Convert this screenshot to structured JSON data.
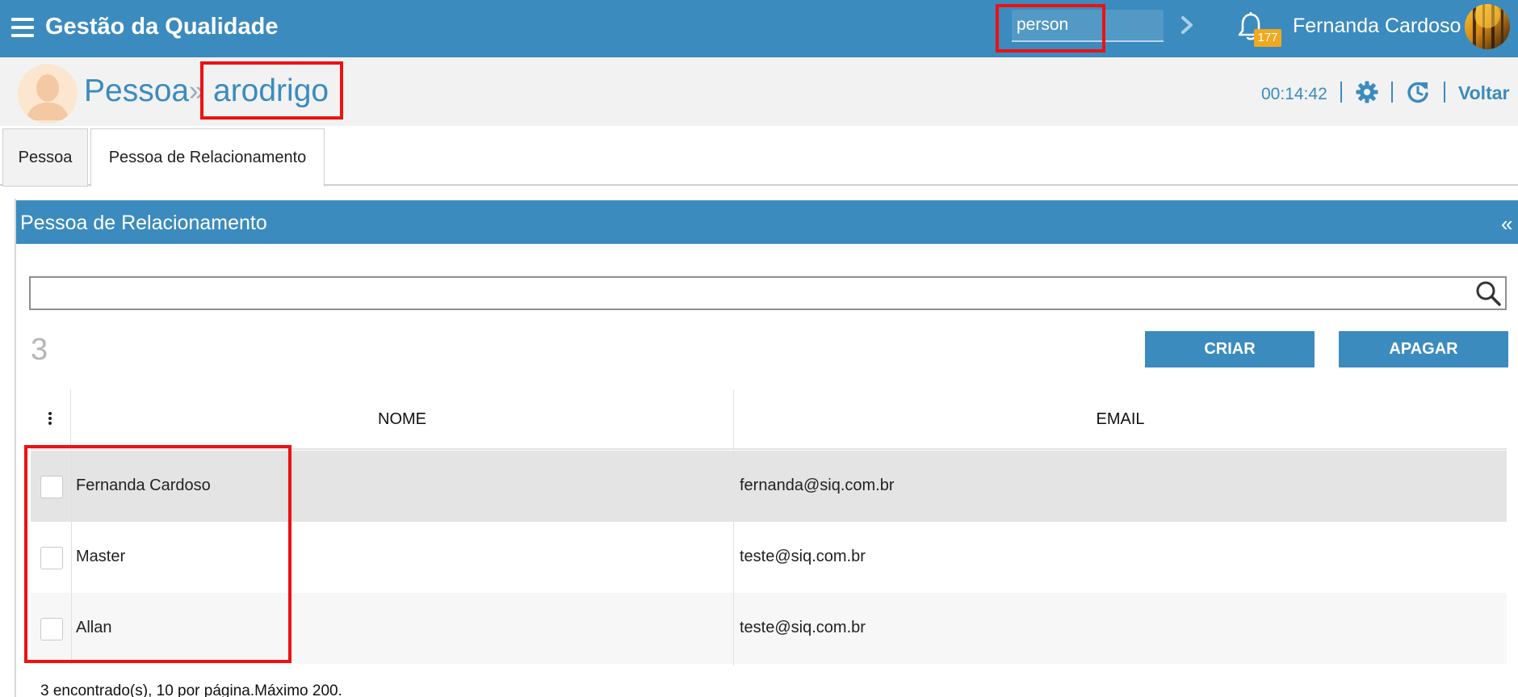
{
  "topbar": {
    "title": "Gestão da Qualidade",
    "search_value": "person",
    "notification_count": "177",
    "user_name": "Fernanda Cardoso"
  },
  "header": {
    "breadcrumb_root": "Pessoa",
    "breadcrumb_separator": "»",
    "breadcrumb_leaf": "arodrigo",
    "timer": "00:14:42",
    "back_label": "Voltar"
  },
  "tabs": [
    {
      "label": "Pessoa",
      "active": false
    },
    {
      "label": "Pessoa de Relacionamento",
      "active": true
    }
  ],
  "panel": {
    "title": "Pessoa de Relacionamento",
    "collapse_symbol": "«",
    "search_value": "",
    "count": "3",
    "create_label": "CRIAR",
    "delete_label": "APAGAR"
  },
  "table": {
    "columns": [
      "NOME",
      "EMAIL"
    ],
    "rows": [
      {
        "name": "Fernanda Cardoso",
        "email": "fernanda@siq.com.br",
        "checked": false
      },
      {
        "name": "Master",
        "email": "teste@siq.com.br",
        "checked": false
      },
      {
        "name": "Allan",
        "email": "teste@siq.com.br",
        "checked": false
      }
    ],
    "footer": "3 encontrado(s), 10 por página.Máximo 200."
  },
  "colors": {
    "primary": "#3b8bbf",
    "badge": "#f2a81d",
    "highlight": "#ee1111",
    "header_bg": "#f2f2f2"
  },
  "icons": {
    "menu": "hamburger-menu-icon",
    "next": "chevron-right-icon",
    "notifications": "bell-icon",
    "settings": "gear-icon",
    "refresh": "refresh-icon",
    "search": "search-icon",
    "columns": "vertical-dots-icon"
  }
}
